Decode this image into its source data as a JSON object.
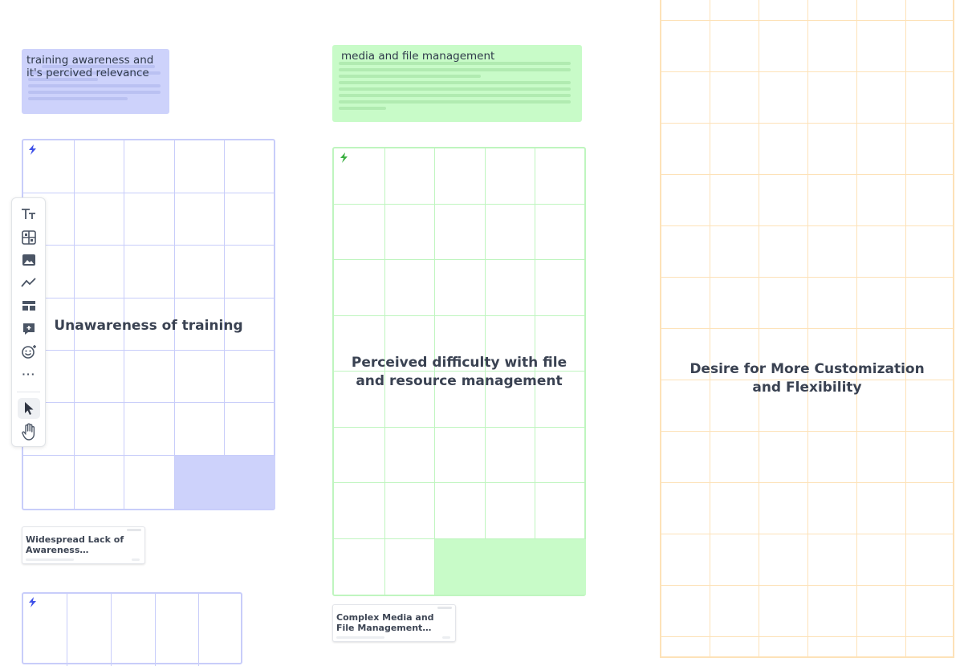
{
  "notes": [
    {
      "text": "training awareness and it's percived relevance",
      "color": "#cdd2fb"
    },
    {
      "text": "media and file management",
      "color": "#c8fbc8"
    }
  ],
  "clusters": [
    {
      "label": "Unawareness of training",
      "border": "#c8cdfa",
      "fill": "#cdd2fb",
      "icon": "bolt-icon"
    },
    {
      "label": "Perceived difficulty with file and resource management",
      "border": "#bff5bf",
      "fill": "#c8fbc8",
      "icon": "bolt-icon"
    },
    {
      "label": "Desire for More Customization and Flexibility",
      "border": "#fde2b8"
    },
    {
      "label": "",
      "border": "#c8cdfa",
      "icon": "bolt-icon"
    }
  ],
  "cards": [
    {
      "title": "Widespread Lack of Awareness Regarding..."
    },
    {
      "title": "Complex Media and File Management Workflows..."
    }
  ],
  "toolbar": {
    "tools": [
      "text-tool-icon",
      "table-tool-icon",
      "image-tool-icon",
      "chart-tool-icon",
      "layout-tool-icon",
      "comment-tool-icon",
      "sticker-tool-icon",
      "more-icon",
      "select-pointer-icon",
      "hand-pan-icon"
    ],
    "more_label": "···",
    "active_tool": "select-pointer-icon"
  }
}
